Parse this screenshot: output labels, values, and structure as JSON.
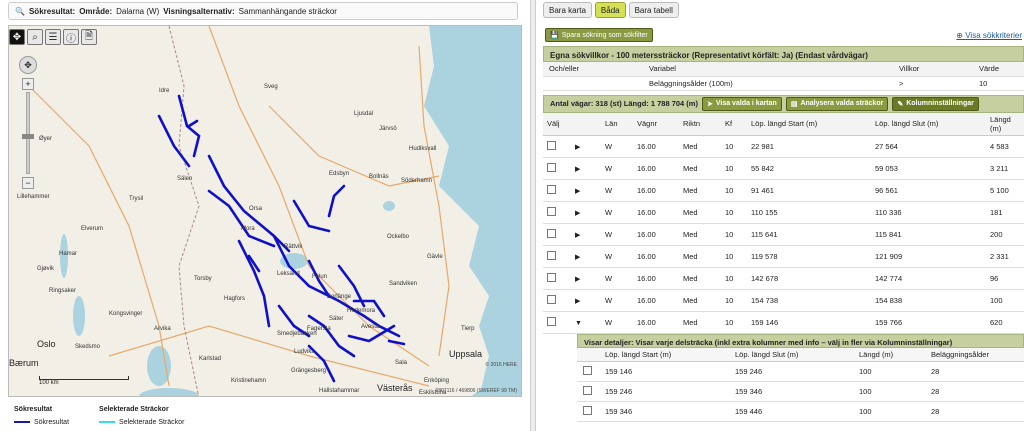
{
  "search_bar": {
    "title": "Sökresultat:",
    "area_label": "Område:",
    "area_value": "Dalarna (W)",
    "alt_label": "Visningsalternativ:",
    "alt_value": "Sammanhängande sträckor"
  },
  "map": {
    "cities_large": [
      "Oslo",
      "Uppsala",
      "Västerås",
      "Bærum"
    ],
    "cities": [
      "Lillehammer",
      "Hudiksvall",
      "Söderhamn",
      "Gävle",
      "Sandviken",
      "Ockelbo",
      "Bollnäs",
      "Edsbyn",
      "Elverum",
      "Hamar",
      "Gjøvik",
      "Kongsvinger",
      "Karlstad",
      "Kristinehamn",
      "Arvika",
      "Skedsmo",
      "Sala",
      "Enköping",
      "Tierp",
      "Grängesberg",
      "Hallstahammar",
      "Ludvika",
      "Eskilstuna",
      "Torsby",
      "Hagfors",
      "Øyer",
      "Ringsaker",
      "Trysil",
      "Idre",
      "Sälen",
      "Mora",
      "Orsa",
      "Rättvik",
      "Leksand",
      "Borlänge",
      "Falun",
      "Avesta",
      "Hedemora",
      "Fagersta",
      "Smedjebacken",
      "Säter",
      "Ljusdal",
      "Sveg",
      "Järvsö"
    ],
    "scale": "100 km",
    "here_text": "© 2016 HERE",
    "copyright": "6807116 / 469806 (SWEREF 99 TM)"
  },
  "legend": {
    "col1_title": "Sökresultat",
    "col1_item": "Sökresultat",
    "col2_title": "Selekterade Sträckor",
    "col2_item": "Selekterade Sträckor",
    "col1_color": "#1a1aa0",
    "col2_color": "#33ddee"
  },
  "view_tabs": [
    "Bara karta",
    "Båda",
    "Bara tabell"
  ],
  "right": {
    "save_btn": "Spara sökning som sökfilter",
    "show_criteria": "Visa sökkriterier",
    "filter_title": "Egna sökvillkor - 100 meterssträckor (Representativt körfält: Ja) (Endast vårdvägar)",
    "filter_headers": [
      "Och/eller",
      "Variabel",
      "Villkor",
      "Värde"
    ],
    "filter_row": [
      "",
      "Beläggningsålder (100m)",
      ">",
      "10"
    ],
    "result_summary": "Antal vägar: 318 (st) Längd: 1 788 704 (m)",
    "btn_show_map": "Visa valda i kartan",
    "btn_analyze": "Analysera valda sträckor",
    "btn_columns": "Kolumninställningar",
    "result_headers": [
      "Välj",
      "",
      "Län",
      "Vägnr",
      "Riktn",
      "Kf",
      "Löp. längd Start (m)",
      "Löp. längd Slut (m)",
      "Längd (m)"
    ],
    "rows": [
      [
        "W",
        "16.00",
        "Med",
        "10",
        "22 981",
        "27 564",
        "4 583"
      ],
      [
        "W",
        "16.00",
        "Med",
        "10",
        "55 842",
        "59 053",
        "3 211"
      ],
      [
        "W",
        "16.00",
        "Med",
        "10",
        "91 461",
        "96 561",
        "5 100"
      ],
      [
        "W",
        "16.00",
        "Med",
        "10",
        "110 155",
        "110 336",
        "181"
      ],
      [
        "W",
        "16.00",
        "Med",
        "10",
        "115 641",
        "115 841",
        "200"
      ],
      [
        "W",
        "16.00",
        "Med",
        "10",
        "119 578",
        "121 909",
        "2 331"
      ],
      [
        "W",
        "16.00",
        "Med",
        "10",
        "142 678",
        "142 774",
        "96"
      ],
      [
        "W",
        "16.00",
        "Med",
        "10",
        "154 738",
        "154 838",
        "100"
      ],
      [
        "W",
        "16.00",
        "Med",
        "10",
        "159 146",
        "159 766",
        "620"
      ]
    ],
    "detail_title": "Visar detaljer: Visar varje delsträcka (inkl extra kolumner med info – välj in fler via Kolumninställningar)",
    "detail_headers": [
      "",
      "Löp. längd Start (m)",
      "Löp. längd Slut (m)",
      "Längd (m)",
      "Beläggningsålder"
    ],
    "detail_rows": [
      [
        "159 146",
        "159 246",
        "100",
        "28"
      ],
      [
        "159 246",
        "159 346",
        "100",
        "28"
      ],
      [
        "159 346",
        "159 446",
        "100",
        "28"
      ]
    ]
  }
}
